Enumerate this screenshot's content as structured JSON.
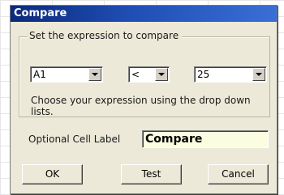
{
  "dialog": {
    "title": "Compare"
  },
  "expression_group": {
    "legend": "Set the expression to compare",
    "left_operand": {
      "value": "A1",
      "icon": "chevron-down-icon"
    },
    "operator": {
      "value": "<",
      "icon": "chevron-down-icon"
    },
    "right_operand": {
      "value": "25",
      "icon": "chevron-down-icon"
    },
    "hint": "Choose your expression using the drop down lists."
  },
  "cell_label": {
    "label": "Optional Cell Label",
    "value": "Compare",
    "input_background": "#fbfde0"
  },
  "buttons": {
    "ok": "OK",
    "test": "Test",
    "cancel": "Cancel"
  },
  "colors": {
    "title_bar": "#1f4eb4",
    "dialog_face": "#ece9d8"
  }
}
